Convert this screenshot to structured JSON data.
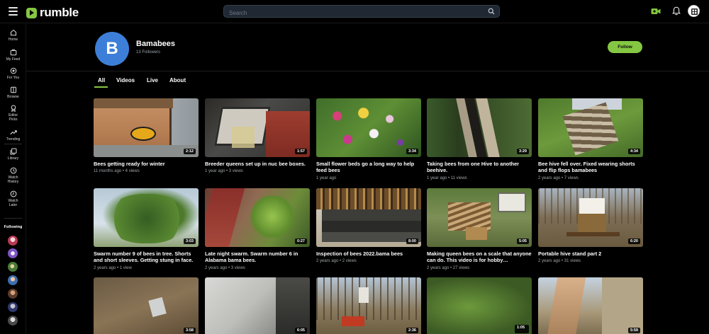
{
  "header": {
    "logo_text": "rumble",
    "search_placeholder": "Search"
  },
  "sidebar": {
    "items": [
      {
        "label": "Home",
        "icon": "home-icon"
      },
      {
        "label": "My Feed",
        "icon": "feed-icon"
      },
      {
        "label": "For You",
        "icon": "for-you-icon"
      },
      {
        "label": "Browse",
        "icon": "browse-icon"
      },
      {
        "label": "Editor Picks",
        "icon": "editor-picks-icon"
      },
      {
        "label": "Trending",
        "icon": "trending-icon"
      },
      {
        "label": "Library",
        "icon": "library-icon"
      },
      {
        "label": "Watch History",
        "icon": "history-icon"
      },
      {
        "label": "Watch Later",
        "icon": "watch-later-icon"
      }
    ],
    "following_label": "Following"
  },
  "channel": {
    "initial": "B",
    "name": "Bamabees",
    "followers": "13 Followers",
    "follow_label": "Follow"
  },
  "tabs": [
    {
      "label": "All",
      "active": true
    },
    {
      "label": "Videos",
      "active": false
    },
    {
      "label": "Live",
      "active": false
    },
    {
      "label": "About",
      "active": false
    }
  ],
  "videos": [
    {
      "title": "Bees getting ready for winter",
      "meta": "11 months ago • 4 views",
      "duration": "2:12"
    },
    {
      "title": "Breeder queens set up in nuc bee boxes.",
      "meta": "1 year ago • 3 views",
      "duration": "1:57"
    },
    {
      "title": "Small flower beds go a long way to help feed bees",
      "meta": "1 year ago",
      "duration": "3:34"
    },
    {
      "title": "Taking bees from one Hive to another beehive.",
      "meta": "1 year ago • 11 views",
      "duration": "3:29"
    },
    {
      "title": "Bee hive fell over. Fixed wearing shorts and flip flops bamabees",
      "meta": "2 years ago • 7 views",
      "duration": "4:34"
    },
    {
      "title": "Swarm number 9 of bees in tree. Shorts and short sleeves. Getting stung in face.",
      "meta": "2 years ago • 1 view",
      "duration": "3:03"
    },
    {
      "title": "Late night swarm. Swarm number 6 in Alabama bama bees.",
      "meta": "2 years ago • 3 views",
      "duration": "0:27"
    },
    {
      "title": "Inspection of bees 2022.bama bees",
      "meta": "2 years ago • 2 views",
      "duration": "8:00"
    },
    {
      "title": "Making queen bees on a scale that anyone can do. This video is for hobby…",
      "meta": "2 years ago • 27 views",
      "duration": "5:05"
    },
    {
      "title": "Portable hive stand part 2",
      "meta": "2 years ago • 31 views",
      "duration": "6:20"
    },
    {
      "title": "",
      "meta": "",
      "duration": "3:58"
    },
    {
      "title": "",
      "meta": "",
      "duration": "6:05"
    },
    {
      "title": "",
      "meta": "",
      "duration": "2:36"
    },
    {
      "title": "",
      "meta": "",
      "duration": "1:05"
    },
    {
      "title": "",
      "meta": "",
      "duration": "5:59"
    }
  ],
  "colors": {
    "accent": "#85c742",
    "background": "#000000",
    "channel_avatar": "#3d7fd8"
  }
}
